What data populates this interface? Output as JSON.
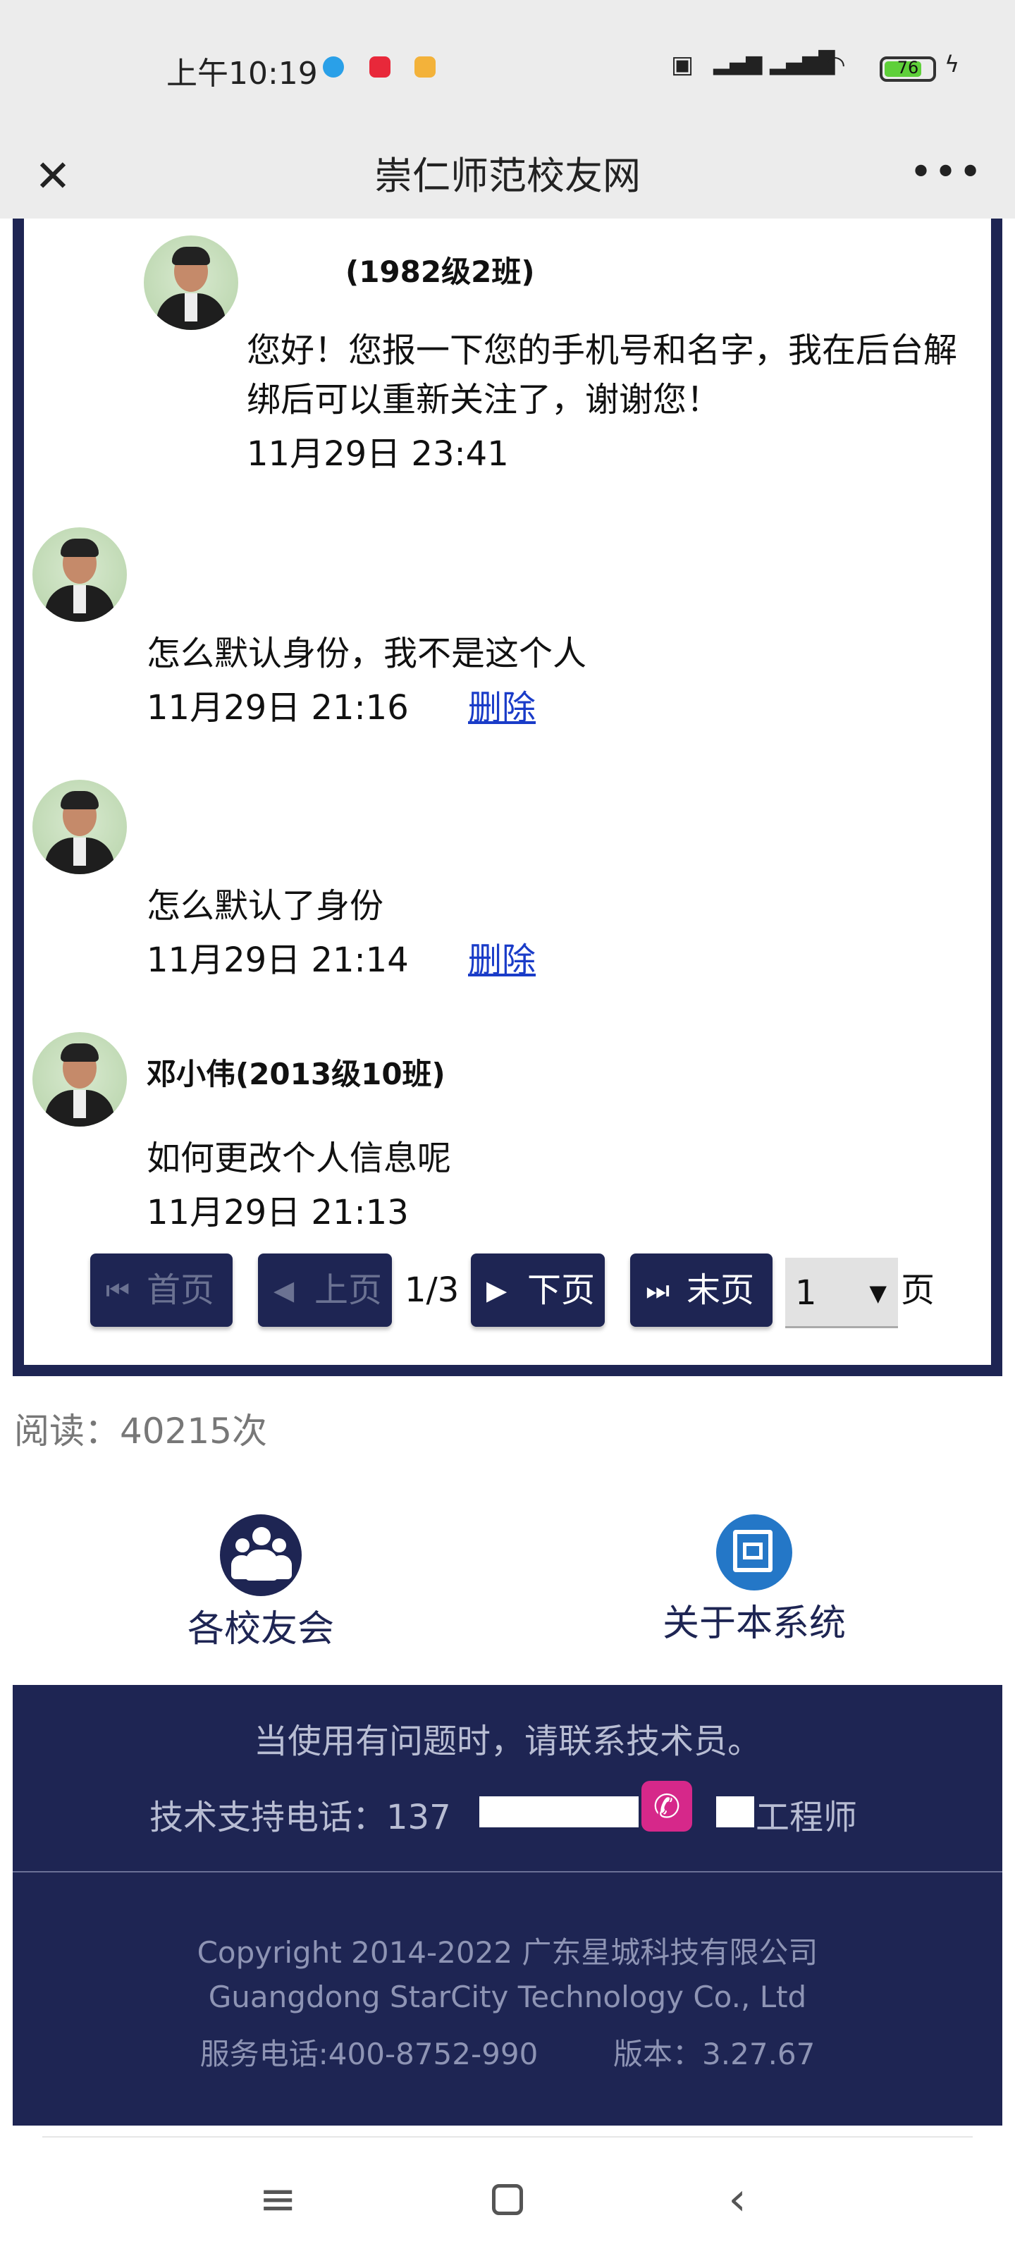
{
  "status_bar": {
    "time": "上午10:19",
    "battery": "76"
  },
  "title_bar": {
    "title": "崇仁师范校友网"
  },
  "messages": [
    {
      "name": "(1982级2班)",
      "text": "您好！您报一下您的手机号和名字，我在后台解绑后可以重新关注了，谢谢您！",
      "time": "11月29日 23:41"
    },
    {
      "name": "",
      "text": "怎么默认身份，我不是这个人",
      "time": "11月29日 21:16",
      "delete": "删除"
    },
    {
      "name": "",
      "text": "怎么默认了身份",
      "time": "11月29日 21:14",
      "delete": "删除"
    },
    {
      "name": "邓小伟(2013级10班)",
      "text": "如何更改个人信息呢",
      "time": "11月29日 21:13"
    }
  ],
  "pager": {
    "first": "首页",
    "prev": "上页",
    "count": "1/3",
    "next": "下页",
    "last": "末页",
    "page_select": "1",
    "page_unit": "页"
  },
  "read_count": "阅读：40215次",
  "footer_links": {
    "alumni": "各校友会",
    "about": "关于本系统"
  },
  "support": {
    "notice": "当使用有问题时，请联系技术员。",
    "phone_label": "技术支持电话：137",
    "engineer": "工程师"
  },
  "copyright": {
    "line1": "Copyright 2014-2022 广东星城科技有限公司",
    "line2": "Guangdong StarCity Technology Co., Ltd",
    "service": "服务电话:400-8752-990",
    "version": "版本：3.27.67"
  },
  "icons": {
    "close": "close-icon",
    "more": "more-icon",
    "phone": "phone-icon",
    "alumni": "people-icon",
    "about": "system-logo-icon"
  },
  "colors": {
    "navy": "#1e2553",
    "link": "#1a3cc8",
    "phone": "#d6288a",
    "about_icon": "#2477c7"
  }
}
